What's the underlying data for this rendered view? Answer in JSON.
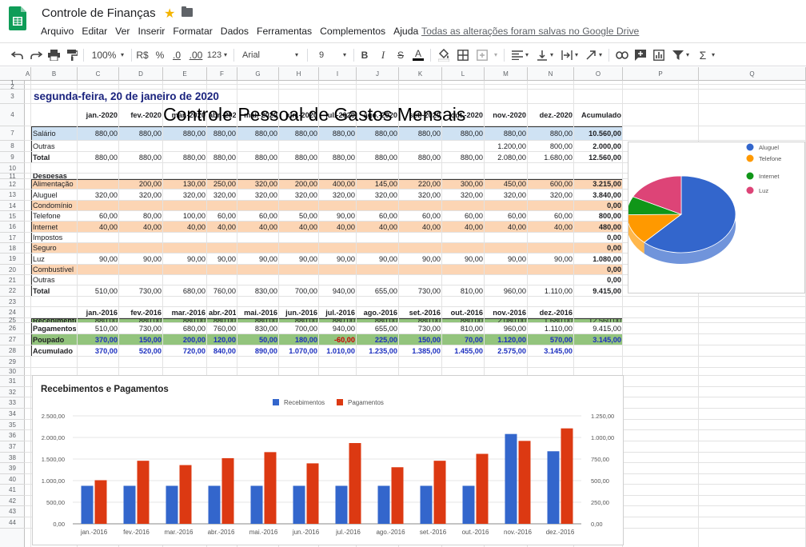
{
  "app": {
    "doc_title": "Controle de Finanças",
    "menu": [
      "Arquivo",
      "Editar",
      "Ver",
      "Inserir",
      "Formatar",
      "Dados",
      "Ferramentas",
      "Complementos",
      "Ajuda"
    ],
    "save_status": "Todas as alterações foram salvas no Google Drive"
  },
  "toolbar": {
    "zoom": "100%",
    "currency": "R$",
    "percent": "%",
    "dec_less": ".0",
    "dec_more": ".00",
    "format_more": "123",
    "font": "Arial",
    "font_size": "9",
    "bold": "B",
    "italic": "I",
    "strike": "S",
    "text_color": "A"
  },
  "columns": [
    "A",
    "B",
    "C",
    "D",
    "E",
    "F",
    "G",
    "H",
    "I",
    "J",
    "K",
    "L",
    "M",
    "N",
    "O",
    "P",
    "Q"
  ],
  "rows": [
    "1",
    "2",
    "3",
    "4",
    "7",
    "8",
    "9",
    "10",
    "11",
    "12",
    "13",
    "14",
    "15",
    "16",
    "17",
    "18",
    "19",
    "20",
    "21",
    "22",
    "23",
    "24",
    "25",
    "26",
    "27",
    "28",
    "29",
    "30",
    "31",
    "32",
    "33",
    "34",
    "35",
    "36",
    "37",
    "38",
    "39",
    "40",
    "41",
    "42",
    "43",
    "44"
  ],
  "sheet": {
    "date": "segunda-feira, 20 de janeiro de 2020",
    "title": "Controle Pessoal de Gastos Mensais",
    "months_2020": [
      "jan.-2020",
      "fev.-2020",
      "mar.-2020",
      "abr.-202",
      "mai.-2020",
      "jun.-2020",
      "jul.-2020",
      "ago.-2020",
      "set.-2020",
      "out.-2020",
      "nov.-2020",
      "dez.-2020",
      "Acumulado"
    ],
    "income": [
      {
        "label": "Salário",
        "values": [
          "880,00",
          "880,00",
          "880,00",
          "880,00",
          "880,00",
          "880,00",
          "880,00",
          "880,00",
          "880,00",
          "880,00",
          "880,00",
          "880,00",
          "10.560,00"
        ]
      },
      {
        "label": "Outras",
        "values": [
          "",
          "",
          "",
          "",
          "",
          "",
          "",
          "",
          "",
          "",
          "1.200,00",
          "800,00",
          "2.000,00"
        ]
      },
      {
        "label": "Total",
        "values": [
          "880,00",
          "880,00",
          "880,00",
          "880,00",
          "880,00",
          "880,00",
          "880,00",
          "880,00",
          "880,00",
          "880,00",
          "2.080,00",
          "1.680,00",
          "12.560,00"
        ]
      }
    ],
    "expenses_title": "Despesas",
    "expenses": [
      {
        "label": "Alimentação",
        "values": [
          "",
          "200,00",
          "130,00",
          "250,00",
          "320,00",
          "200,00",
          "400,00",
          "145,00",
          "220,00",
          "300,00",
          "450,00",
          "600,00",
          "3.215,00"
        ]
      },
      {
        "label": "Aluguel",
        "values": [
          "320,00",
          "320,00",
          "320,00",
          "320,00",
          "320,00",
          "320,00",
          "320,00",
          "320,00",
          "320,00",
          "320,00",
          "320,00",
          "320,00",
          "3.840,00"
        ]
      },
      {
        "label": "Condomínio",
        "values": [
          "",
          "",
          "",
          "",
          "",
          "",
          "",
          "",
          "",
          "",
          "",
          "",
          "0,00"
        ]
      },
      {
        "label": "Telefone",
        "values": [
          "60,00",
          "80,00",
          "100,00",
          "60,00",
          "60,00",
          "50,00",
          "90,00",
          "60,00",
          "60,00",
          "60,00",
          "60,00",
          "60,00",
          "800,00"
        ]
      },
      {
        "label": "Internet",
        "values": [
          "40,00",
          "40,00",
          "40,00",
          "40,00",
          "40,00",
          "40,00",
          "40,00",
          "40,00",
          "40,00",
          "40,00",
          "40,00",
          "40,00",
          "480,00"
        ]
      },
      {
        "label": "Impostos",
        "values": [
          "",
          "",
          "",
          "",
          "",
          "",
          "",
          "",
          "",
          "",
          "",
          "",
          "0,00"
        ]
      },
      {
        "label": "Seguro",
        "values": [
          "",
          "",
          "",
          "",
          "",
          "",
          "",
          "",
          "",
          "",
          "",
          "",
          "0,00"
        ]
      },
      {
        "label": "Luz",
        "values": [
          "90,00",
          "90,00",
          "90,00",
          "90,00",
          "90,00",
          "90,00",
          "90,00",
          "90,00",
          "90,00",
          "90,00",
          "90,00",
          "90,00",
          "1.080,00"
        ]
      },
      {
        "label": "Combustível",
        "values": [
          "",
          "",
          "",
          "",
          "",
          "",
          "",
          "",
          "",
          "",
          "",
          "",
          "0,00"
        ]
      },
      {
        "label": "Outras",
        "values": [
          "",
          "",
          "",
          "",
          "",
          "",
          "",
          "",
          "",
          "",
          "",
          "",
          "0,00"
        ]
      },
      {
        "label": "Total",
        "values": [
          "510,00",
          "730,00",
          "680,00",
          "760,00",
          "830,00",
          "700,00",
          "940,00",
          "655,00",
          "730,00",
          "810,00",
          "960,00",
          "1.110,00",
          "9.415,00"
        ]
      }
    ],
    "months_2016": [
      "jan.-2016",
      "fev.-2016",
      "mar.-2016",
      "abr.-201",
      "mai.-2016",
      "jun.-2016",
      "jul.-2016",
      "ago.-2016",
      "set.-2016",
      "out.-2016",
      "nov.-2016",
      "dez.-2016"
    ],
    "summary": [
      {
        "label": "Recebimentos",
        "values": [
          "880,00",
          "880,00",
          "880,00",
          "880,00",
          "880,00",
          "880,00",
          "880,00",
          "880,00",
          "880,00",
          "880,00",
          "2.080,00",
          "1.680,00",
          "12.560,00"
        ]
      },
      {
        "label": "Pagamentos",
        "values": [
          "510,00",
          "730,00",
          "680,00",
          "760,00",
          "830,00",
          "700,00",
          "940,00",
          "655,00",
          "730,00",
          "810,00",
          "960,00",
          "1.110,00",
          "9.415,00"
        ]
      },
      {
        "label": "Poupado",
        "values": [
          "370,00",
          "150,00",
          "200,00",
          "120,00",
          "50,00",
          "180,00",
          "-60,00",
          "225,00",
          "150,00",
          "70,00",
          "1.120,00",
          "570,00",
          "3.145,00"
        ]
      },
      {
        "label": "Acumulado",
        "values": [
          "370,00",
          "520,00",
          "720,00",
          "840,00",
          "890,00",
          "1.070,00",
          "1.010,00",
          "1.235,00",
          "1.385,00",
          "1.455,00",
          "2.575,00",
          "3.145,00",
          ""
        ]
      }
    ]
  },
  "chart_data": [
    {
      "type": "bar",
      "title": "Recebimentos e Pagamentos",
      "categories": [
        "jan.-2016",
        "fev.-2016",
        "mar.-2016",
        "abr.-2016",
        "mai.-2016",
        "jun.-2016",
        "jul.-2016",
        "ago.-2016",
        "set.-2016",
        "out.-2016",
        "nov.-2016",
        "dez.-2016"
      ],
      "series": [
        {
          "name": "Recebimentos",
          "color": "#3366cc",
          "values": [
            880,
            880,
            880,
            880,
            880,
            880,
            880,
            880,
            880,
            880,
            2080,
            1680
          ]
        },
        {
          "name": "Pagamentos",
          "color": "#dc3912",
          "values": [
            1010,
            1460,
            1360,
            1520,
            1660,
            1400,
            1870,
            1310,
            1460,
            1620,
            1920,
            2210
          ]
        }
      ],
      "ylim": [
        0,
        2500
      ],
      "yticks_left": [
        "0,00",
        "500,00",
        "1.000,00",
        "1.500,00",
        "2.000,00",
        "2.500,00"
      ],
      "yticks_right": [
        "0,00",
        "250,00",
        "500,00",
        "750,00",
        "1.000,00",
        "1.250,00"
      ],
      "legend": "top",
      "grid": true
    },
    {
      "type": "pie",
      "labels": [
        "Aluguel",
        "Telefone",
        "Internet",
        "Luz"
      ],
      "values": [
        3840,
        800,
        480,
        1080
      ],
      "colors": [
        "#3366cc",
        "#ff9900",
        "#109618",
        "#dd4477"
      ],
      "legend": "right"
    }
  ]
}
